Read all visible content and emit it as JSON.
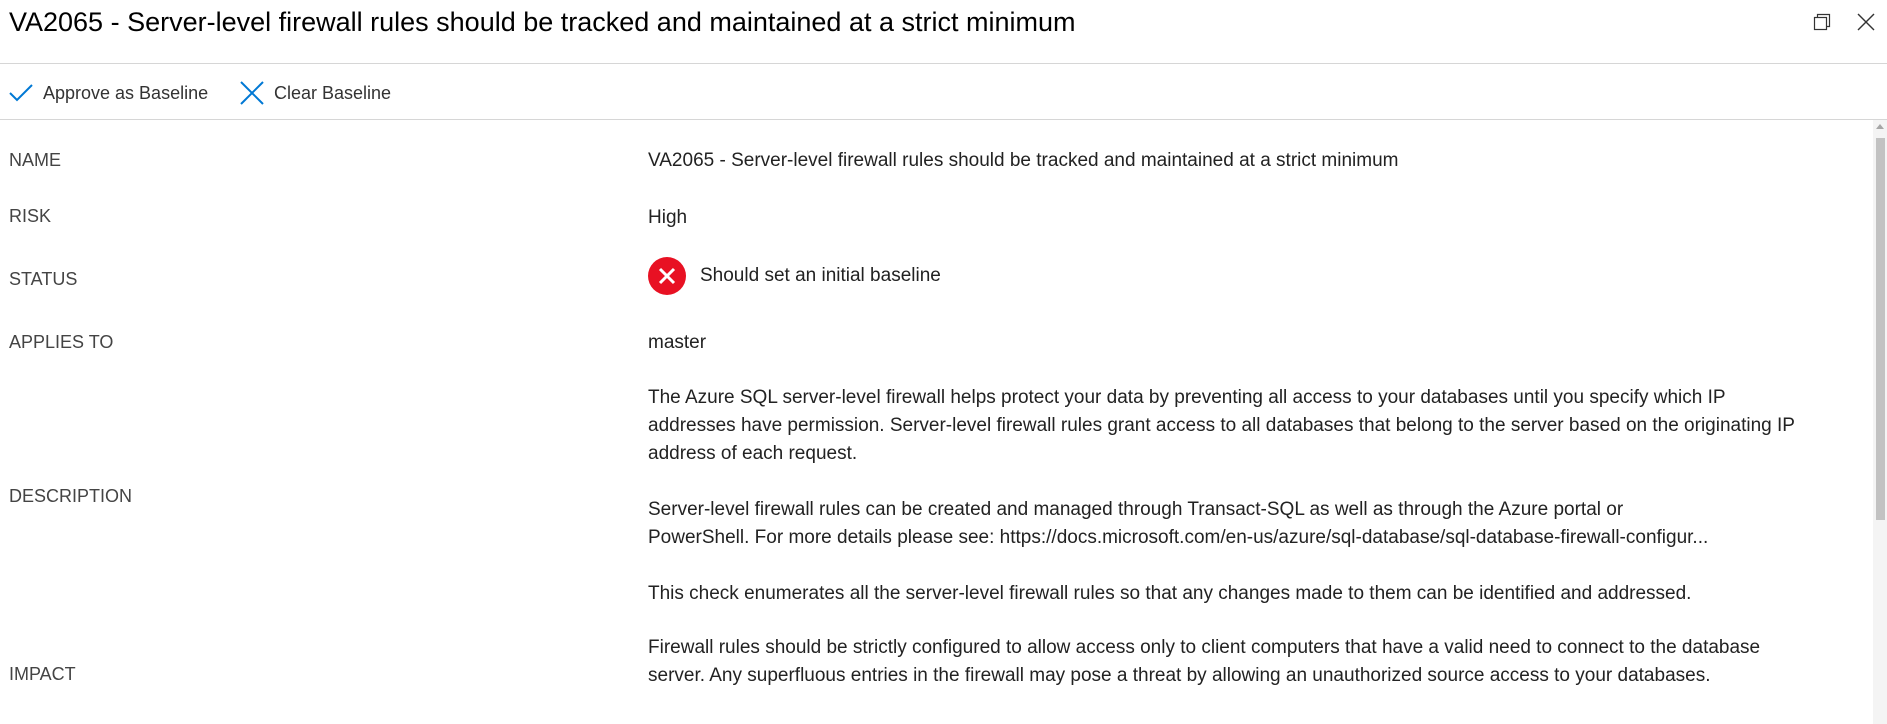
{
  "header": {
    "title": "VA2065 - Server-level firewall rules should be tracked and maintained at a strict minimum"
  },
  "window_controls": [
    "restore-icon",
    "close-icon"
  ],
  "toolbar": {
    "approve_label": "Approve as Baseline",
    "clear_label": "Clear Baseline",
    "approve_icon": "checkmark-icon",
    "clear_icon": "x-icon"
  },
  "details": {
    "name_label": "NAME",
    "name_value": "VA2065 - Server-level firewall rules should be tracked and maintained at a strict minimum",
    "risk_label": "RISK",
    "risk_value": "High",
    "status_label": "STATUS",
    "status_value": "Should set an initial baseline",
    "status_icon": "error-icon",
    "applies_label": "APPLIES TO",
    "applies_value": "master",
    "description_label": "DESCRIPTION",
    "description_p1": "The Azure SQL server-level firewall helps protect your data by preventing all access to your databases until you specify which IP addresses have permission. Server-level firewall rules grant access to all databases that belong to the server based on the originating IP address of each request.",
    "description_p2_line1": "Server-level firewall rules can be created and managed through Transact-SQL as well as through the Azure portal or",
    "description_p2_line2": "PowerShell. For more details please see: https://docs.microsoft.com/en-us/azure/sql-database/sql-database-firewall-configur...",
    "description_p3": "This check enumerates all the server-level firewall rules so that any changes made to them can be identified and addressed.",
    "impact_label": "IMPACT",
    "impact_value": "Firewall rules should be strictly configured to allow access only to client computers that have a valid need to connect to the database server. Any superfluous entries in the firewall may pose a threat by allowing an unauthorized source access to your databases."
  },
  "colors": {
    "accent": "#0078d4",
    "error": "#e81123",
    "divider": "#d6d6d6"
  }
}
